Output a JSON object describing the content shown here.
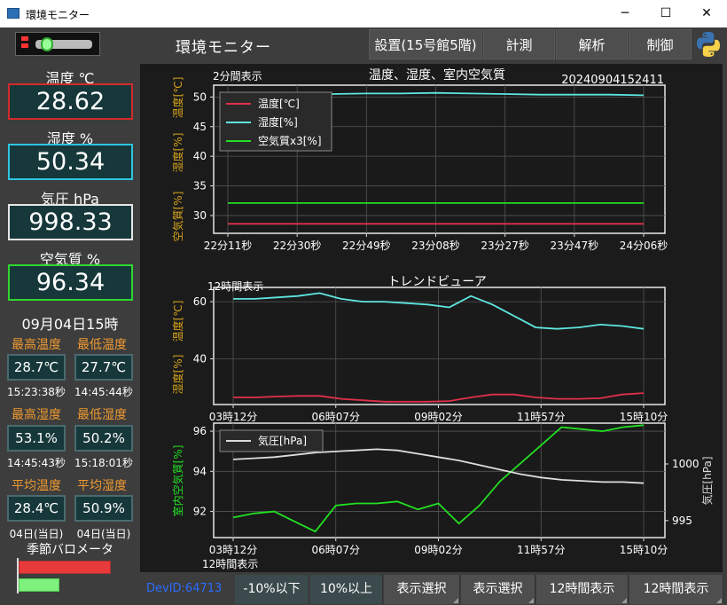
{
  "window": {
    "title": "環境モニター",
    "min": "─",
    "max": "☐",
    "close": "✕"
  },
  "header": {
    "app_title": "環境モニター",
    "buttons": {
      "setup": "設置(15号館5階)",
      "measure": "計測",
      "analysis": "解析",
      "control": "制御"
    }
  },
  "readings": [
    {
      "label": "温度 ℃",
      "value": "28.62",
      "border": "#d42a2a"
    },
    {
      "label": "湿度 %",
      "value": "50.34",
      "border": "#2ec4e0"
    },
    {
      "label": "気圧 hPa",
      "value": "998.33",
      "border": "#e6e6e6"
    },
    {
      "label": "空気質 %",
      "value": "96.34",
      "border": "#2fd62f"
    }
  ],
  "stats": {
    "date": "09月04日15時",
    "max_temp_label": "最高温度",
    "min_temp_label": "最低温度",
    "max_temp": "28.7℃",
    "min_temp": "27.7℃",
    "max_temp_time": "15:23:38秒",
    "min_temp_time": "14:45:44秒",
    "max_hum_label": "最高湿度",
    "min_hum_label": "最低湿度",
    "max_hum": "53.1%",
    "min_hum": "50.2%",
    "max_hum_time": "14:45:43秒",
    "min_hum_time": "15:18:01秒",
    "avg_temp_label": "平均温度",
    "avg_hum_label": "平均湿度",
    "avg_temp": "28.4℃",
    "avg_hum": "50.9%",
    "avg_temp_note": "04日(当日)",
    "avg_hum_note": "04日(当日)",
    "season_label": "季節バロメータ",
    "season_bars": [
      {
        "color": "#e83a3a"
      },
      {
        "color": "#7df07d"
      }
    ]
  },
  "footer": {
    "dev_id": "DevID:64713"
  },
  "bottom_buttons": [
    "-10%以下",
    "10%以上",
    "表示選択",
    "表示選択",
    "12時間表示",
    "12時間表示"
  ],
  "chart_data": [
    {
      "type": "line",
      "title": "温度、湿度、室内空気質",
      "subtitle_left": "2分間表示",
      "timestamp": "20240904152411",
      "ylabel_parts": [
        "空気質[%]",
        "湿度[%]",
        "温度[℃]"
      ],
      "ylim": [
        27,
        52
      ],
      "yticks": [
        30,
        35,
        40,
        45,
        50
      ],
      "xticks": [
        "22分11秒",
        "22分30秒",
        "22分49秒",
        "23分08秒",
        "23分27秒",
        "23分47秒",
        "24分06秒"
      ],
      "legend": [
        "温度[℃]",
        "湿度[%]",
        "空気質x3[%]"
      ],
      "legend_position": "top-left",
      "grid": true,
      "series": [
        {
          "name": "温度[℃]",
          "color": "#e0304a",
          "values": [
            28.6,
            28.6,
            28.6,
            28.6,
            28.6,
            28.6,
            28.6,
            28.6,
            28.6,
            28.6,
            28.6,
            28.6,
            28.6
          ]
        },
        {
          "name": "湿度[%]",
          "color": "#5ee6e0",
          "values": [
            50.7,
            50.6,
            50.6,
            50.5,
            50.6,
            50.6,
            50.7,
            50.6,
            50.5,
            50.4,
            50.4,
            50.4,
            50.3
          ]
        },
        {
          "name": "空気質x3[%]",
          "color": "#22e022",
          "values": [
            32.1,
            32.1,
            32.1,
            32.1,
            32.1,
            32.1,
            32.1,
            32.1,
            32.1,
            32.1,
            32.1,
            32.1,
            32.1
          ]
        }
      ]
    },
    {
      "type": "line",
      "title": "トレンドビューア",
      "subtitle_left": "12時間表示",
      "ylabel_parts": [
        "湿度[%]",
        "温度[℃]"
      ],
      "ylim": [
        24,
        65
      ],
      "yticks": [
        40,
        60
      ],
      "xticks": [
        "03時12分",
        "06時07分",
        "09時02分",
        "11時57分",
        "15時10分"
      ],
      "grid": true,
      "series": [
        {
          "name": "湿度",
          "color": "#5ee6e0",
          "values": [
            61,
            61,
            61.5,
            62,
            63,
            61,
            60,
            60,
            59.5,
            59,
            58,
            62,
            59,
            55,
            51,
            50.5,
            51,
            52,
            51.5,
            50.5
          ]
        },
        {
          "name": "温度",
          "color": "#e0304a",
          "values": [
            26.5,
            26.5,
            26.8,
            27,
            27,
            26,
            25.5,
            25,
            25,
            25,
            25.2,
            26.5,
            27.5,
            27.5,
            26.5,
            26,
            26,
            26.2,
            27.5,
            28
          ]
        }
      ]
    },
    {
      "type": "line",
      "subtitle_bottom": "12時間表示",
      "ylabel": "室内空気質[%]",
      "y2label": "気圧[hPa]",
      "ylim": [
        90.7,
        96.4
      ],
      "yticks": [
        92,
        94,
        96
      ],
      "y2lim": [
        993.5,
        1003.6
      ],
      "y2ticks": [
        995,
        1000
      ],
      "xticks": [
        "03時12分",
        "06時07分",
        "09時02分",
        "11時57分",
        "15時10分"
      ],
      "legend": [
        "気圧[hPa]"
      ],
      "legend_position": "top-left",
      "grid": true,
      "series": [
        {
          "name": "空気質",
          "color": "#22e022",
          "values": [
            91.7,
            91.9,
            92,
            91.5,
            91.0,
            92.3,
            92.4,
            92.4,
            92.5,
            92.1,
            92.4,
            91.4,
            92.3,
            93.5,
            94.4,
            95.3,
            96.2,
            96.1,
            96.0,
            96.2,
            96.3
          ]
        },
        {
          "name": "気圧[hPa]",
          "color": "#dddddd",
          "axis": "right",
          "values": [
            1000.4,
            1000.5,
            1000.6,
            1000.8,
            1001.0,
            1001.1,
            1001.2,
            1001.3,
            1001.2,
            1000.9,
            1000.6,
            1000.3,
            999.9,
            999.5,
            999.1,
            998.8,
            998.6,
            998.5,
            998.4,
            998.4,
            998.3
          ]
        }
      ]
    }
  ]
}
